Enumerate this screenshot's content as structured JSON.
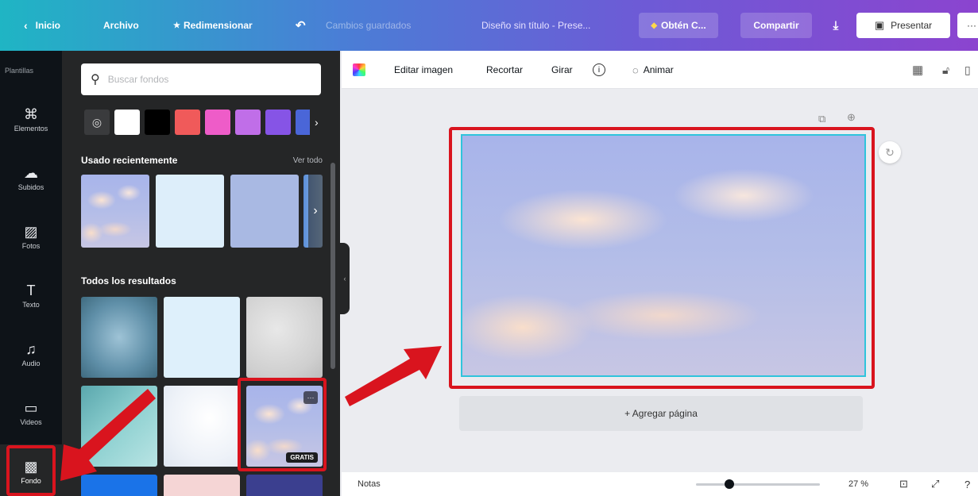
{
  "topbar": {
    "home": "Inicio",
    "file": "Archivo",
    "resize": "Redimensionar",
    "saved_status": "Cambios guardados",
    "doc_title": "Diseño sin título - Prese...",
    "upgrade": "Obtén C...",
    "share": "Compartir",
    "present": "Presentar",
    "more": "···"
  },
  "rail": {
    "top_label": "Plantillas",
    "items": [
      {
        "label": "Elementos",
        "icon": "elements-icon"
      },
      {
        "label": "Subidos",
        "icon": "upload-icon"
      },
      {
        "label": "Fotos",
        "icon": "photo-icon"
      },
      {
        "label": "Texto",
        "icon": "text-icon"
      },
      {
        "label": "Audio",
        "icon": "music-icon"
      },
      {
        "label": "Videos",
        "icon": "video-icon"
      },
      {
        "label": "Fondo",
        "icon": "background-icon"
      }
    ]
  },
  "panel": {
    "search_placeholder": "Buscar fondos",
    "swatch_colors": [
      "#ffffff",
      "#000000",
      "#f05a5a",
      "#ee5cc8",
      "#c06ee8",
      "#8654e6",
      "#4a66d8"
    ],
    "recent_title": "Usado recientemente",
    "see_all": "Ver todo",
    "all_results_title": "Todos los resultados",
    "free_badge": "GRATIS",
    "more_badge": "···"
  },
  "toolbar": {
    "edit_image": "Editar imagen",
    "crop": "Recortar",
    "flip": "Girar",
    "info": "i",
    "animate": "Animar"
  },
  "canvas": {
    "add_page": "+ Agregar página"
  },
  "bottombar": {
    "notes": "Notas",
    "zoom": "27 %",
    "zoom_fraction": 0.27
  },
  "colors": {
    "annotation_red": "#d9141e",
    "panel_bg": "#252627",
    "rail_bg": "#0e1318",
    "selection_cyan": "#2fc4dc"
  }
}
